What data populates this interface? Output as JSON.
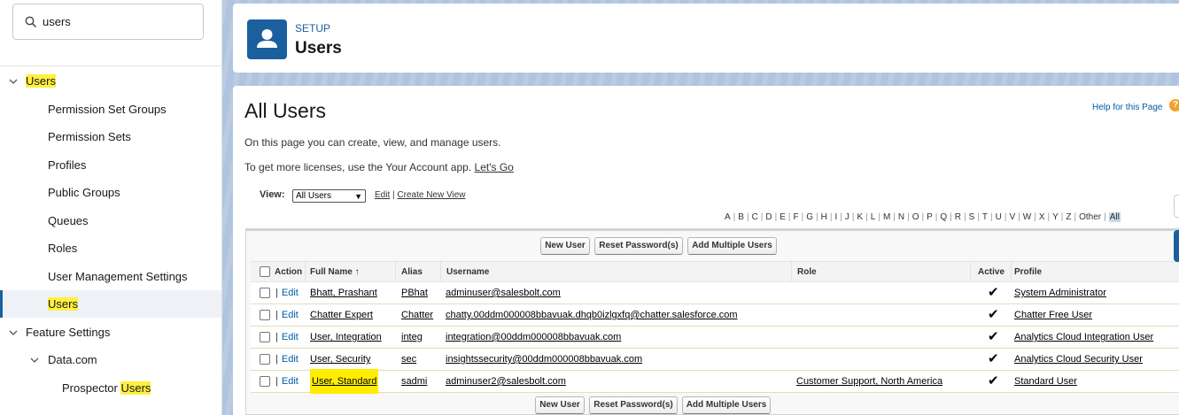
{
  "sidebar": {
    "search": {
      "value": "users",
      "icon": "search-icon"
    },
    "items": [
      {
        "label": "Users",
        "highlight": true,
        "expanded": true,
        "level": 0
      },
      {
        "label": "Permission Set Groups",
        "level": 1
      },
      {
        "label": "Permission Sets",
        "level": 1
      },
      {
        "label": "Profiles",
        "level": 1
      },
      {
        "label": "Public Groups",
        "level": 1
      },
      {
        "label": "Queues",
        "level": 1
      },
      {
        "label": "Roles",
        "level": 1
      },
      {
        "label": "User Management Settings",
        "level": 1
      },
      {
        "label": "Users",
        "level": 1,
        "selected": true,
        "highlight": true
      },
      {
        "label": "Feature Settings",
        "level": 0,
        "expanded": true
      },
      {
        "label": "Data.com",
        "level": 1,
        "expanded": true
      },
      {
        "label_prefix": "Prospector ",
        "label_highlight": "Users",
        "level": 2
      }
    ]
  },
  "header": {
    "setup": "SETUP",
    "title": "Users"
  },
  "page": {
    "title": "All Users",
    "help_link": "Help for this Page",
    "help_icon": "?",
    "description": "On this page you can create, view, and manage users.",
    "licenses_text": "To get more licenses, use the Your Account app.",
    "licenses_link": "Let's Go"
  },
  "view": {
    "label": "View:",
    "selected": "All Users",
    "edit": "Edit",
    "separator": "|",
    "create_new": "Create New View"
  },
  "alphabet": [
    "A",
    "B",
    "C",
    "D",
    "E",
    "F",
    "G",
    "H",
    "I",
    "J",
    "K",
    "L",
    "M",
    "N",
    "O",
    "P",
    "Q",
    "R",
    "S",
    "T",
    "U",
    "V",
    "W",
    "X",
    "Y",
    "Z",
    "Other",
    "All"
  ],
  "buttons": {
    "new_user": "New User",
    "reset_password": "Reset Password(s)",
    "add_multiple": "Add Multiple Users"
  },
  "table": {
    "columns": {
      "action": "Action",
      "full_name": "Full Name",
      "sort_arrow": "↑",
      "alias": "Alias",
      "username": "Username",
      "role": "Role",
      "active": "Active",
      "profile": "Profile"
    },
    "edit_label": "Edit",
    "pipe": "|",
    "check_glyph": "✔",
    "rows": [
      {
        "full_name": "Bhatt, Prashant",
        "alias": "PBhat",
        "username": "adminuser@salesbolt.com",
        "role": "",
        "active": true,
        "profile": "System Administrator"
      },
      {
        "full_name": "Chatter Expert",
        "alias": "Chatter",
        "username": "chatty.00ddm000008bbavuak.dhqb0izlgxfq@chatter.salesforce.com",
        "role": "",
        "active": true,
        "profile": "Chatter Free User"
      },
      {
        "full_name": "User, Integration",
        "alias": "integ",
        "username": "integration@00ddm000008bbavuak.com",
        "role": "",
        "active": true,
        "profile": "Analytics Cloud Integration User"
      },
      {
        "full_name": "User, Security",
        "alias": "sec",
        "username": "insightssecurity@00ddm000008bbavuak.com",
        "role": "",
        "active": true,
        "profile": "Analytics Cloud Security User"
      },
      {
        "full_name": "User, Standard",
        "alias": "sadmi",
        "username": "adminuser2@salesbolt.com",
        "role": "Customer Support, North America",
        "active": true,
        "profile": "Standard User",
        "highlight": true
      }
    ]
  },
  "colors": {
    "brand": "#1b5f9e",
    "highlight": "#ffed00",
    "link": "#015ba7",
    "background": "#b0c4df"
  }
}
